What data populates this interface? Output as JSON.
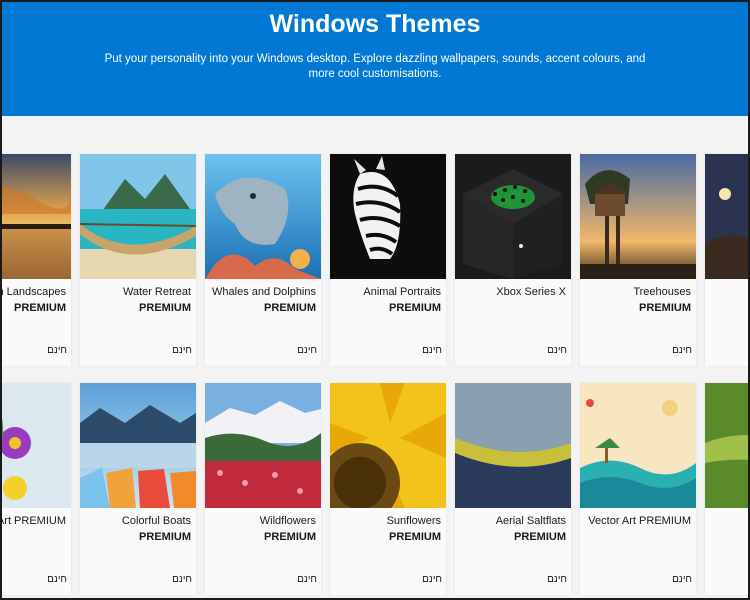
{
  "header": {
    "title": "Windows Themes",
    "subtitle": "Put your personality into your Windows desktop. Explore dazzling wallpapers, sounds, accent colours, and more cool customisations."
  },
  "colors": {
    "accent": "#0078d4"
  },
  "rows": [
    {
      "cards": [
        {
          "name": "n Landscapes",
          "tag": "PREMIUM",
          "price": "חינם",
          "image": "sunset-lake"
        },
        {
          "name": "Water Retreat",
          "tag": "PREMIUM",
          "price": "חינם",
          "image": "hammock-bay"
        },
        {
          "name": "Whales and Dolphins",
          "tag": "PREMIUM",
          "price": "חינם",
          "image": "dolphin"
        },
        {
          "name": "Animal Portraits",
          "tag": "PREMIUM",
          "price": "חינם",
          "image": "zebra"
        },
        {
          "name": "Xbox Series X",
          "tag": "",
          "price": "חינם",
          "image": "xbox"
        },
        {
          "name": "Treehouses",
          "tag": "PREMIUM",
          "price": "חינם",
          "image": "treehouse"
        },
        {
          "name": "",
          "tag": "",
          "price": "",
          "image": "night-road"
        }
      ]
    },
    {
      "cards": [
        {
          "name": "Art PREMIUM",
          "tag": "",
          "price": "חינם",
          "image": "flower-art"
        },
        {
          "name": "Colorful Boats",
          "tag": "PREMIUM",
          "price": "חינם",
          "image": "boats"
        },
        {
          "name": "Wildflowers",
          "tag": "PREMIUM",
          "price": "חינם",
          "image": "wildflowers"
        },
        {
          "name": "Sunflowers",
          "tag": "PREMIUM",
          "price": "חינם",
          "image": "sunflower"
        },
        {
          "name": "Aerial Saltflats",
          "tag": "PREMIUM",
          "price": "חינם",
          "image": "saltflats"
        },
        {
          "name": "Vector Art PREMIUM",
          "tag": "",
          "price": "חינם",
          "image": "vector-art"
        },
        {
          "name": "",
          "tag": "",
          "price": "",
          "image": "green-leaf"
        }
      ]
    }
  ]
}
